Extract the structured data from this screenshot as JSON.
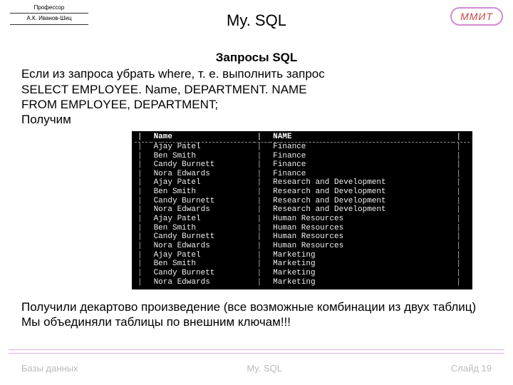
{
  "header": {
    "prof": "Профессор",
    "author": "А.К. Иванов-Шиц",
    "title": "My. SQL",
    "badge": "ММИТ"
  },
  "body": {
    "subtitle": "Запросы SQL",
    "p1": "Если из запроса убрать where, т. е. выполнить запрос",
    "p2": "SELECT EMPLOYEE. Name, DEPARTMENT. NAME",
    "p3": "FROM EMPLOYEE, DEPARTMENT;",
    "p4": "Получим",
    "concl1": "Получили декартово произведение (все возможные комбинации из двух таблиц)",
    "concl2": "Мы объединяли таблицы по внешним ключам!!!"
  },
  "terminal": {
    "headers": [
      "Name",
      "NAME"
    ],
    "rows": [
      [
        "Ajay Patel",
        "Finance"
      ],
      [
        "Ben Smith",
        "Finance"
      ],
      [
        "Candy Burnett",
        "Finance"
      ],
      [
        "Nora Edwards",
        "Finance"
      ],
      [
        "Ajay Patel",
        "Research and Development"
      ],
      [
        "Ben Smith",
        "Research and Development"
      ],
      [
        "Candy Burnett",
        "Research and Development"
      ],
      [
        "Nora Edwards",
        "Research and Development"
      ],
      [
        "Ajay Patel",
        "Human Resources"
      ],
      [
        "Ben Smith",
        "Human Resources"
      ],
      [
        "Candy Burnett",
        "Human Resources"
      ],
      [
        "Nora Edwards",
        "Human Resources"
      ],
      [
        "Ajay Patel",
        "Marketing"
      ],
      [
        "Ben Smith",
        "Marketing"
      ],
      [
        "Candy Burnett",
        "Marketing"
      ],
      [
        "Nora Edwards",
        "Marketing"
      ]
    ]
  },
  "footer": {
    "left": "Базы данных",
    "center": "My. SQL",
    "right": "Слайд 19"
  }
}
